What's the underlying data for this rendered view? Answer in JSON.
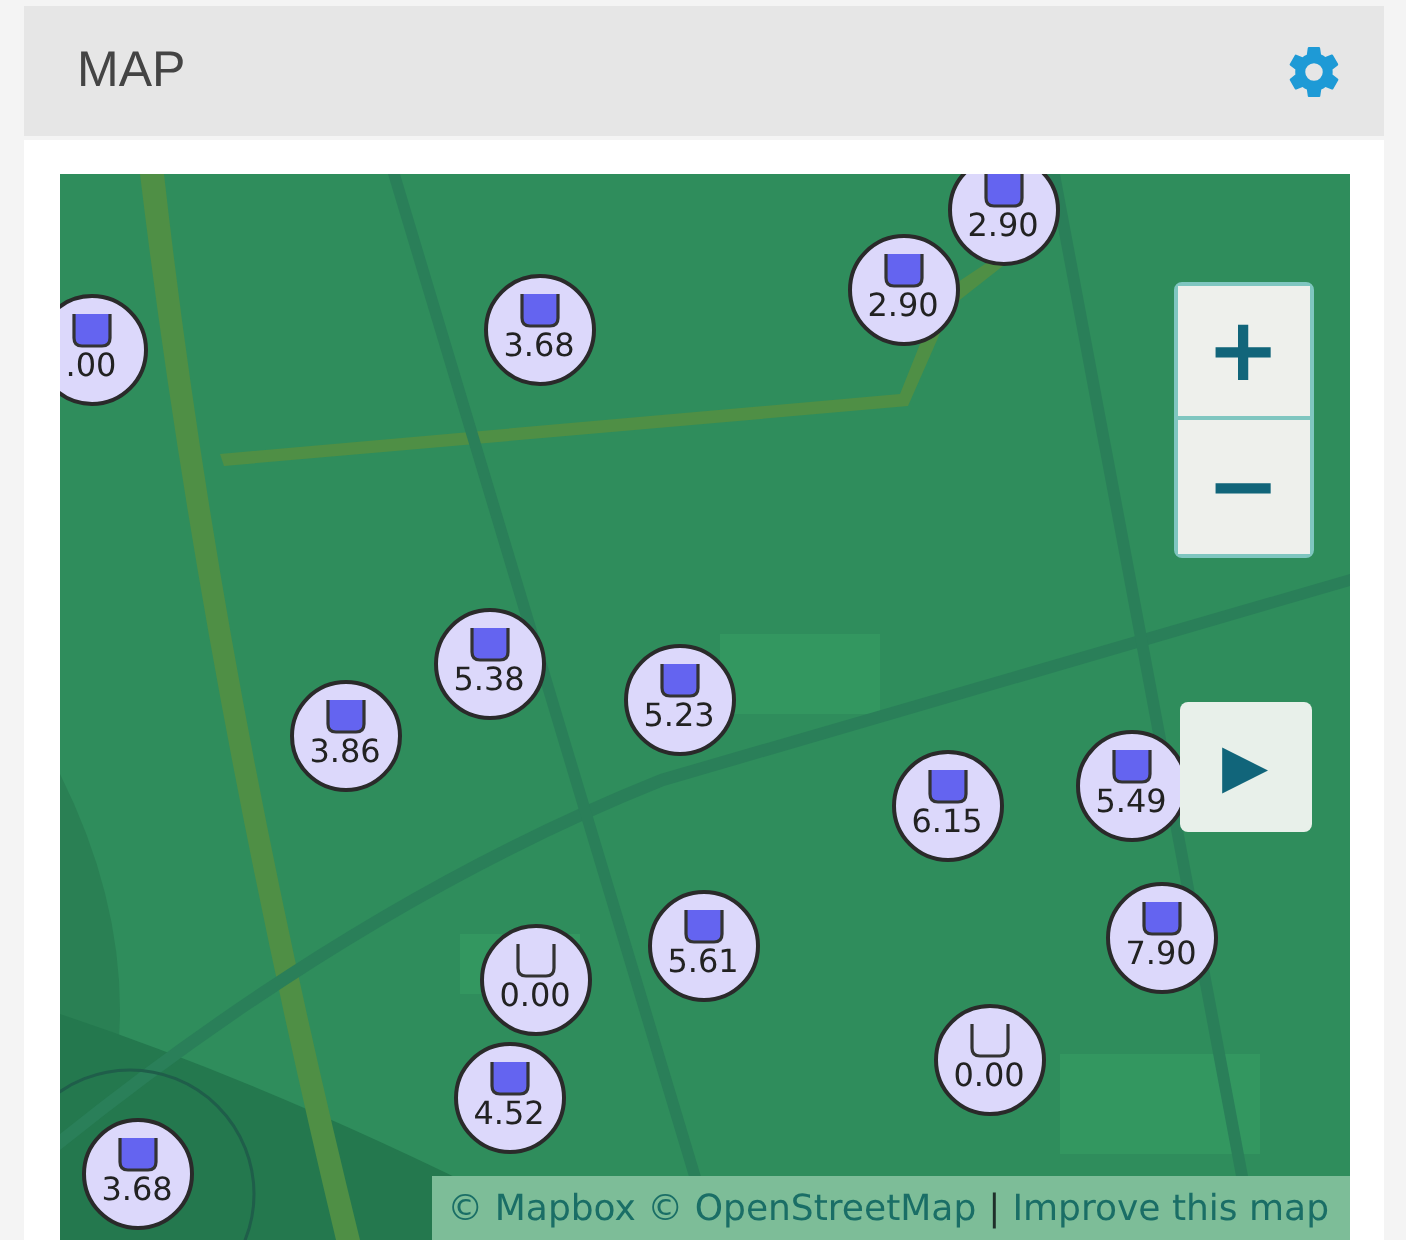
{
  "header": {
    "title": "MAP"
  },
  "markers": [
    {
      "value": ".00",
      "filled": true
    },
    {
      "value": "3.68",
      "filled": true
    },
    {
      "value": "2.90",
      "filled": true
    },
    {
      "value": "2.90",
      "filled": true
    },
    {
      "value": "5.38",
      "filled": true
    },
    {
      "value": "3.86",
      "filled": true
    },
    {
      "value": "5.23",
      "filled": true
    },
    {
      "value": "6.15",
      "filled": true
    },
    {
      "value": "5.49",
      "filled": true
    },
    {
      "value": "0.00",
      "filled": false
    },
    {
      "value": "5.61",
      "filled": true
    },
    {
      "value": "7.90",
      "filled": true
    },
    {
      "value": "0.00",
      "filled": false
    },
    {
      "value": "4.52",
      "filled": true
    },
    {
      "value": "3.68",
      "filled": true
    }
  ],
  "zoom_controls": [
    {
      "kind": "plus",
      "label": "+"
    },
    {
      "kind": "minus",
      "label": "−"
    }
  ],
  "play_button": {
    "label": "▶"
  },
  "attribution": {
    "source": "© Mapbox © OpenStreetMap",
    "separator": "|",
    "link": "Improve this map"
  }
}
